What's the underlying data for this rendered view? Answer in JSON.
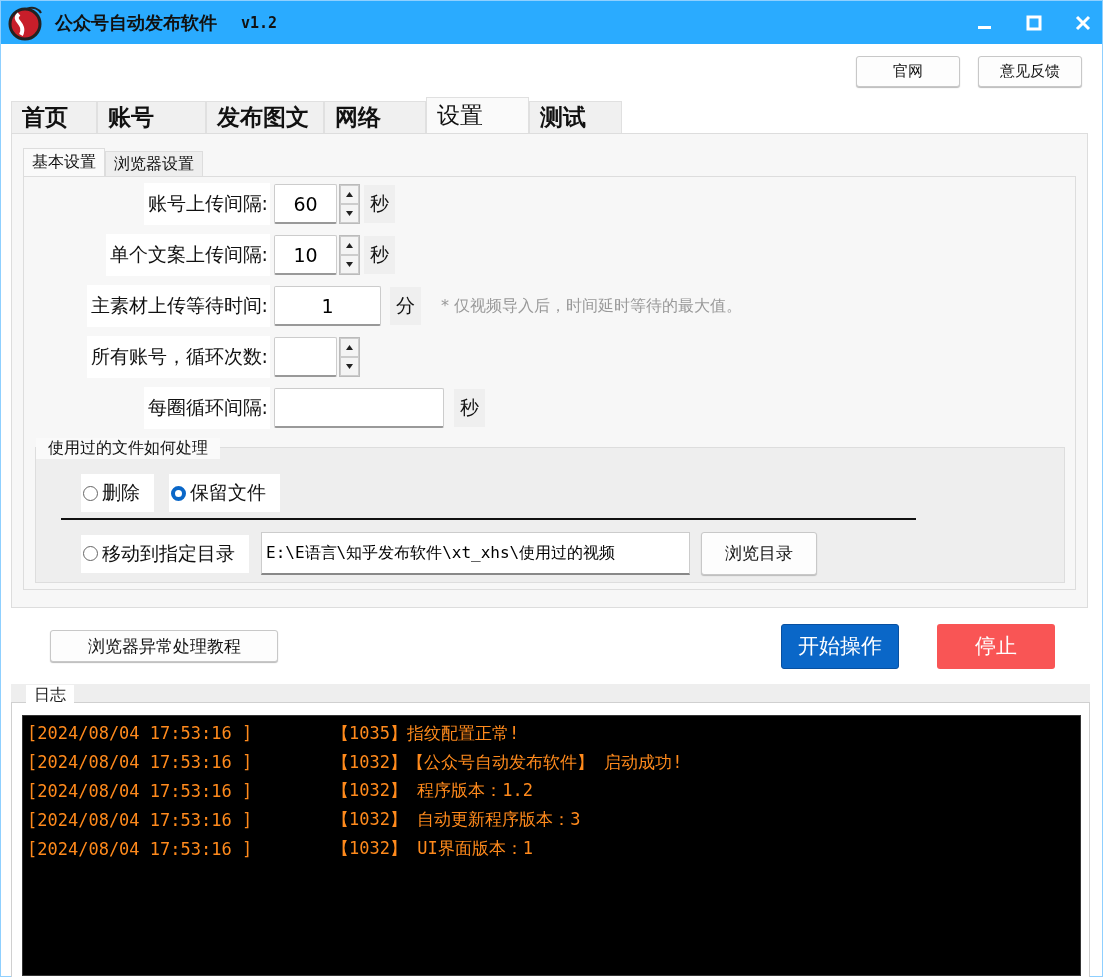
{
  "window": {
    "title": "公众号自动发布软件",
    "version": "v1.2"
  },
  "header_buttons": [
    "官网",
    "意见反馈"
  ],
  "tabs": [
    {
      "label": "首页",
      "selected": false
    },
    {
      "label": "账号",
      "selected": false
    },
    {
      "label": "发布图文",
      "selected": false
    },
    {
      "label": "网络",
      "selected": false
    },
    {
      "label": "设置",
      "selected": true
    },
    {
      "label": "测试",
      "selected": false
    }
  ],
  "subtabs": [
    {
      "label": "基本设置",
      "selected": true
    },
    {
      "label": "浏览器设置",
      "selected": false
    }
  ],
  "fields": [
    {
      "kind": "spin",
      "label": "账号上传间隔:",
      "value": "60",
      "unit": "秒"
    },
    {
      "kind": "spin",
      "label": "单个文案上传间隔:",
      "value": "10",
      "unit": "秒"
    },
    {
      "kind": "medium",
      "label": "主素材上传等待时间:",
      "value": "1",
      "unit": "分",
      "note": "* 仅视频导入后，时间延时等待的最大值。"
    },
    {
      "kind": "spin",
      "label": "所有账号，循环次数:"
    },
    {
      "kind": "wide",
      "label": "每圈循环间隔:",
      "unit": "秒"
    }
  ],
  "file_handling": {
    "title": "使用过的文件如何处理",
    "options": [
      {
        "label": "删除",
        "selected": false
      },
      {
        "label": "保留文件",
        "selected": true
      },
      {
        "label": "移动到指定目录",
        "selected": false
      }
    ],
    "path": "E:\\E语言\\知乎发布软件\\xt_xhs\\使用过的视频",
    "browse_button": "浏览目录"
  },
  "tutorial_button": "浏览器异常处理教程",
  "start_button": "开始操作",
  "stop_button": "停止",
  "log": {
    "title": "日志",
    "entries": [
      {
        "time": "[2024/08/04 17:53:16 ]",
        "message": "【1035】指纹配置正常!"
      },
      {
        "time": "[2024/08/04 17:53:16 ]",
        "message": "【1032】【公众号自动发布软件】 启动成功!"
      },
      {
        "time": "[2024/08/04 17:53:16 ]",
        "message": "【1032】 程序版本：1.2"
      },
      {
        "time": "[2024/08/04 17:53:16 ]",
        "message": "【1032】 自动更新程序版本：3"
      },
      {
        "time": "[2024/08/04 17:53:16 ]",
        "message": "【1032】 UI界面版本：1"
      }
    ]
  }
}
